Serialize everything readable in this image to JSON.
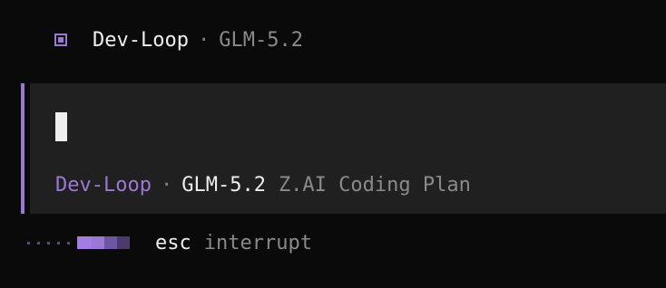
{
  "header": {
    "icon": "agent-square-icon",
    "agent_name": "Dev-Loop",
    "separator": "·",
    "model": "GLM-5.2"
  },
  "prompt": {
    "accent_color": "#9b78d4",
    "status": {
      "agent": "Dev-Loop",
      "separator": "·",
      "model": "GLM-5.2",
      "provider": "Z.AI Coding Plan"
    }
  },
  "footer": {
    "spinner_icon": "progress-spinner-icon",
    "key": "esc",
    "action": "interrupt"
  },
  "colors": {
    "background": "#0a0a0a",
    "panel": "#202020",
    "accent": "#9b78d4",
    "text": "#eeeeee",
    "muted": "#8a8a8a"
  }
}
